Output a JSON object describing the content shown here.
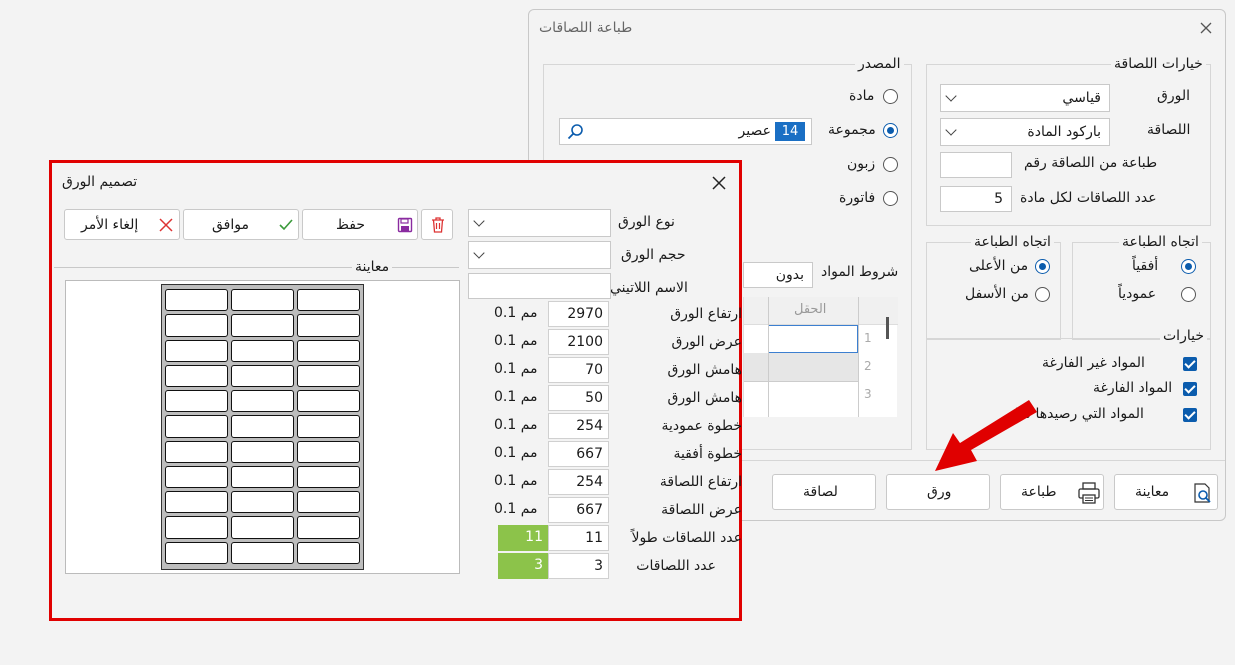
{
  "main_dialog": {
    "title": "طباعة اللصاقات",
    "label_options": {
      "title": "خيارات اللصاقة",
      "paper_label": "الورق",
      "paper_value": "قياسي",
      "label_label": "اللصاقة",
      "label_value": "باركود المادة",
      "print_from_label": "طباعة من اللصاقة رقم",
      "print_from_value": "",
      "count_per_item_label": "عدد اللصاقات لكل مادة",
      "count_per_item_value": "5"
    },
    "source": {
      "title": "المصدر",
      "options": [
        "مادة",
        "مجموعة",
        "زبون",
        "فاتورة"
      ],
      "selected": "مجموعة",
      "group_code": "14",
      "group_name": "عصير"
    },
    "material_conditions": {
      "label": "شروط المواد",
      "value": "بدون",
      "grid_header": "الحقل",
      "row_numbers": [
        "1",
        "2",
        "3"
      ]
    },
    "print_direction_1": {
      "title": "اتجاه الطباعة",
      "options": [
        "أفقياً",
        "عمودياً"
      ],
      "selected": "أفقياً"
    },
    "print_direction_2": {
      "title": "اتجاه الطباعة",
      "options": [
        "من الأعلى",
        "من الأسفل"
      ],
      "selected": "من الأعلى"
    },
    "options": {
      "title": "خيارات",
      "items": [
        "المواد غير الفارغة",
        "المواد الفارغة",
        "المواد التي رصيدها سا"
      ]
    },
    "buttons": {
      "preview": "معاينة",
      "print": "طباعة",
      "paper": "ورق",
      "label": "لصاقة"
    }
  },
  "paper_dialog": {
    "title": "تصميم الورق",
    "buttons": {
      "cancel": "إلغاء الأمر",
      "ok": "موافق",
      "save": "حفظ"
    },
    "preview_label": "معاينة",
    "paper_type_label": "نوع الورق",
    "paper_size_label": "حجم الورق",
    "latin_name_label": "الاسم اللاتيني",
    "unit": "0.1 مم",
    "fields": [
      {
        "label": "ارتفاع الورق",
        "value": "2970"
      },
      {
        "label": "عرض الورق",
        "value": "2100"
      },
      {
        "label": "هامش الورق",
        "value": "70"
      },
      {
        "label": "هامش الورق",
        "value": "50"
      },
      {
        "label": "خطوة عمودية",
        "value": "254"
      },
      {
        "label": "خطوة أفقية",
        "value": "667"
      },
      {
        "label": "ارتفاع اللصاقة",
        "value": "254"
      },
      {
        "label": "عرض اللصاقة",
        "value": "667"
      }
    ],
    "count_tall_label": "عدد اللصاقات طولاً",
    "count_tall_value": "11",
    "count_tall_calc": "11",
    "count_label": "عدد اللصاقات",
    "count_value": "3",
    "count_calc": "3",
    "preview_grid": {
      "rows": 11,
      "cols": 3
    }
  },
  "colors": {
    "accent": "#0b5cad",
    "highlight_border": "#e00000",
    "arrow": "#e00000",
    "green": "#8cc34a"
  }
}
